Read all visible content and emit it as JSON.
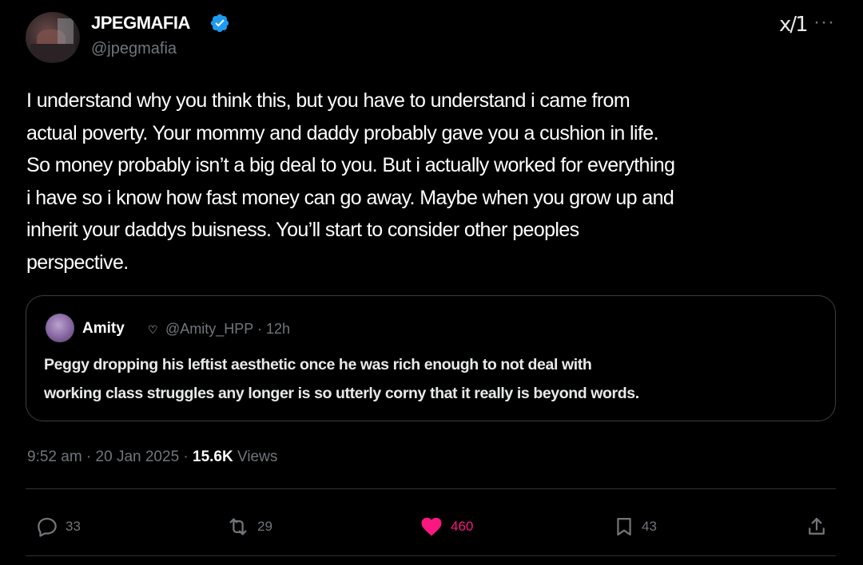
{
  "author": {
    "display_name": "JPEGMAFIA",
    "handle": "@jpegmafia",
    "verified": true
  },
  "header_icons": {
    "xai_label": "x/1",
    "more_label": "···"
  },
  "tweet": {
    "text": "I understand why you think this, but you have to understand i came from\nactual poverty. Your mommy and daddy probably gave you a cushion in life.\nSo money probably isn’t a big deal to you. But i actually worked for everything\ni have so i know how fast money can go away. Maybe when you grow up and\ninherit your daddys buisness. You’ll start to consider other peoples\nperspective."
  },
  "quote": {
    "name": "Amity",
    "badge": "♡",
    "handle_time": "@Amity_HPP · 12h",
    "text": "Peggy dropping his leftist aesthetic once he was rich enough to not deal with\nworking class struggles any longer is so utterly corny that it really is beyond words."
  },
  "meta": {
    "timestamp": "9:52 am · 20 Jan 2025 · ",
    "views_count": "15.6K",
    "views_label": " Views"
  },
  "actions": {
    "reply_count": "33",
    "repost_count": "29",
    "like_count": "460",
    "bookmark_count": "43"
  },
  "colors": {
    "background": "#000000",
    "text": "#e7e9ea",
    "muted": "#71767b",
    "verified": "#1d9bf0",
    "like": "#f91880",
    "border": "#2f3336"
  }
}
